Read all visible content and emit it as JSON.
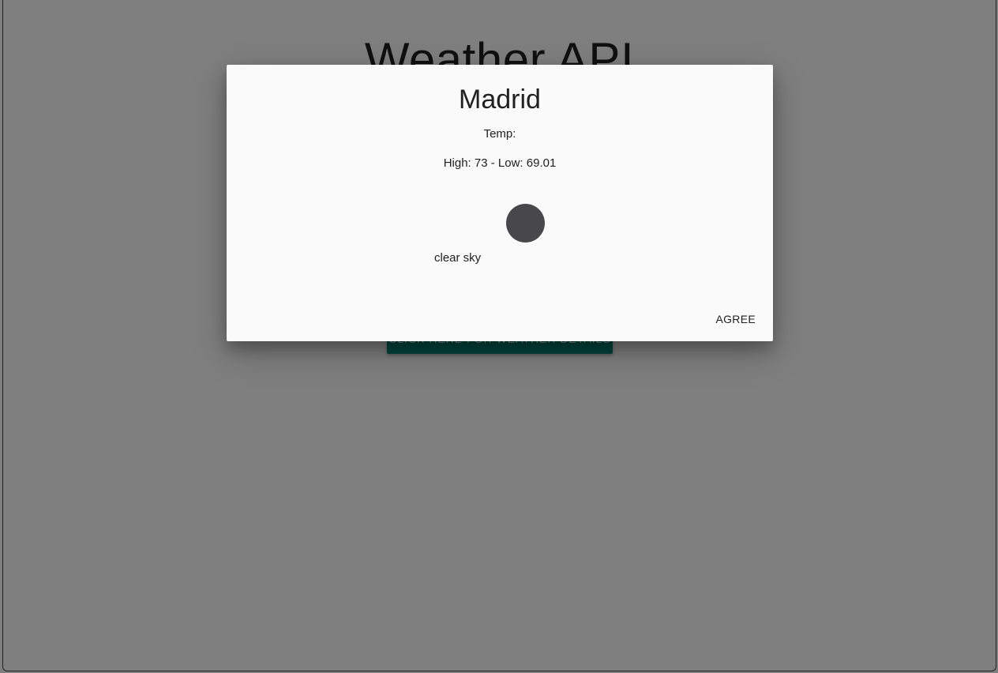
{
  "page": {
    "title": "Weather API",
    "details_button_label": "CLICK HERE FOR WEATHER DETAILS"
  },
  "dialog": {
    "city": "Madrid",
    "temp_label": "Temp:",
    "high_low": "High: 73 - Low: 69.01",
    "description": "clear sky",
    "weather_icon": "weather-icon",
    "agree_label": "AGREE"
  },
  "colors": {
    "accent": "#00897b",
    "overlay": "rgba(0,0,0,0.5)",
    "dialog_bg": "#fafafa",
    "icon": "#48484a"
  }
}
